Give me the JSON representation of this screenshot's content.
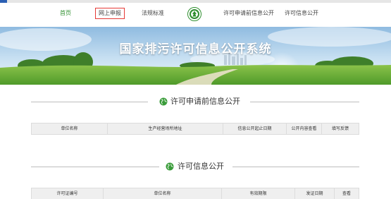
{
  "nav": {
    "items": [
      {
        "label": "首页",
        "state": "active"
      },
      {
        "label": "网上申报",
        "state": "boxed"
      },
      {
        "label": "法规标准",
        "state": "normal"
      },
      {
        "label": "许可申请前信息公开",
        "state": "normal"
      },
      {
        "label": "许可信息公开",
        "state": "normal"
      }
    ],
    "emblem_icon": "environmental-protection-emblem"
  },
  "banner": {
    "title": "国家排污许可信息公开系统"
  },
  "section1": {
    "title": "许可申请前信息公开",
    "icon": "globe-icon",
    "columns": [
      "单位名称",
      "生产经营场所地址",
      "信息公开起止日期",
      "公开内容查看",
      "填写反馈"
    ]
  },
  "section2": {
    "title": "许可信息公开",
    "icon": "globe-icon",
    "columns": [
      "许可证编号",
      "单位名称",
      "有效期限",
      "发证日期",
      "查看"
    ]
  },
  "colors": {
    "accent_green": "#2f8f2f",
    "highlight_red": "#e53935",
    "divider": "#bdbdbd",
    "table_header_bg": "#efefef"
  }
}
